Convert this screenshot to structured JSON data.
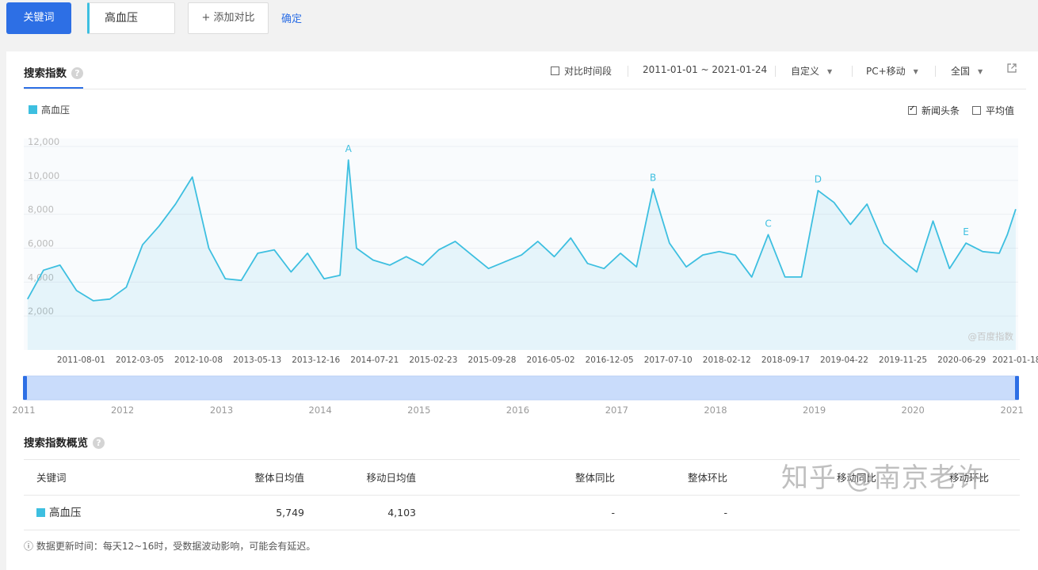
{
  "topbar": {
    "keyword_button": "关键词",
    "term": "高血压",
    "add_compare": "添加对比",
    "confirm": "确定"
  },
  "panel": {
    "tab_title": "搜索指数",
    "compare_period": "对比时间段",
    "date_range": "2011-01-01 ~ 2021-01-24",
    "custom": "自定义",
    "device": "PC+移动",
    "region": "全国"
  },
  "chart_options": {
    "news_headlines": "新闻头条",
    "news_checked": true,
    "average": "平均值",
    "average_checked": false
  },
  "chart_data": {
    "type": "area",
    "series": [
      {
        "name": "高血压",
        "color": "#3dbfe0",
        "x": [
          "2011-01",
          "2011-03",
          "2011-05",
          "2011-07",
          "2011-09",
          "2011-11",
          "2012-01",
          "2012-03",
          "2012-05",
          "2012-07",
          "2012-09",
          "2012-11",
          "2013-01",
          "2013-03",
          "2013-05",
          "2013-07",
          "2013-09",
          "2013-11",
          "2014-01",
          "2014-03",
          "2014-04",
          "2014-05",
          "2014-07",
          "2014-09",
          "2014-11",
          "2015-01",
          "2015-03",
          "2015-05",
          "2015-07",
          "2015-09",
          "2015-11",
          "2016-01",
          "2016-03",
          "2016-05",
          "2016-07",
          "2016-09",
          "2016-11",
          "2017-01",
          "2017-03",
          "2017-05",
          "2017-07",
          "2017-09",
          "2017-11",
          "2018-01",
          "2018-03",
          "2018-05",
          "2018-07",
          "2018-09",
          "2018-11",
          "2019-01",
          "2019-03",
          "2019-05",
          "2019-07",
          "2019-09",
          "2019-11",
          "2020-01",
          "2020-03",
          "2020-05",
          "2020-07",
          "2020-09",
          "2020-11",
          "2020-12",
          "2021-01"
        ],
        "values": [
          3000,
          4700,
          5000,
          3500,
          2900,
          3000,
          3700,
          6200,
          7300,
          8600,
          10200,
          6000,
          4200,
          4100,
          5700,
          5900,
          4600,
          5700,
          4200,
          4400,
          11200,
          6000,
          5300,
          5000,
          5500,
          5000,
          5900,
          6400,
          5600,
          4800,
          5200,
          5600,
          6400,
          5500,
          6600,
          5100,
          4800,
          5700,
          4900,
          9500,
          6300,
          4900,
          5600,
          5800,
          5600,
          4300,
          6800,
          4300,
          4300,
          9400,
          8700,
          7400,
          8600,
          6300,
          5400,
          4600,
          7600,
          4800,
          6300,
          5800,
          5700,
          6800,
          8300
        ]
      }
    ],
    "annotations": [
      {
        "label": "A",
        "x": "2014-04",
        "value": 11200
      },
      {
        "label": "B",
        "x": "2017-05",
        "value": 9500
      },
      {
        "label": "C",
        "x": "2018-07",
        "value": 6800
      },
      {
        "label": "D",
        "x": "2019-01",
        "value": 9400
      },
      {
        "label": "E",
        "x": "2020-07",
        "value": 6300
      }
    ],
    "y_ticks": [
      "2,000",
      "4,000",
      "6,000",
      "8,000",
      "10,000",
      "12,000"
    ],
    "ylim": [
      0,
      12000
    ],
    "x_tick_labels": [
      "2011-08-01",
      "2012-03-05",
      "2012-10-08",
      "2013-05-13",
      "2013-12-16",
      "2014-07-21",
      "2015-02-23",
      "2015-09-28",
      "2016-05-02",
      "2016-12-05",
      "2017-07-10",
      "2018-02-12",
      "2018-09-17",
      "2019-04-22",
      "2019-11-25",
      "2020-06-29",
      "2021-01-18"
    ],
    "range_years": [
      "2011",
      "2012",
      "2013",
      "2014",
      "2015",
      "2016",
      "2017",
      "2018",
      "2019",
      "2020",
      "2021"
    ],
    "source_label": "@百度指数",
    "grid": true
  },
  "overview": {
    "title": "搜索指数概览",
    "headers": {
      "keyword": "关键词",
      "overall_avg": "整体日均值",
      "mobile_avg": "移动日均值",
      "overall_yoy": "整体同比",
      "overall_mom": "整体环比",
      "mobile_yoy": "移动同比",
      "mobile_mom": "移动环比"
    },
    "row": {
      "keyword": "高血压",
      "overall_avg": "5,749",
      "mobile_avg": "4,103",
      "overall_yoy": "-",
      "overall_mom": "-"
    }
  },
  "footnote": "ⓘ 数据更新时间：每天12~16时，受数据波动影响，可能会有延迟。",
  "watermark": "知乎 @南京老许"
}
